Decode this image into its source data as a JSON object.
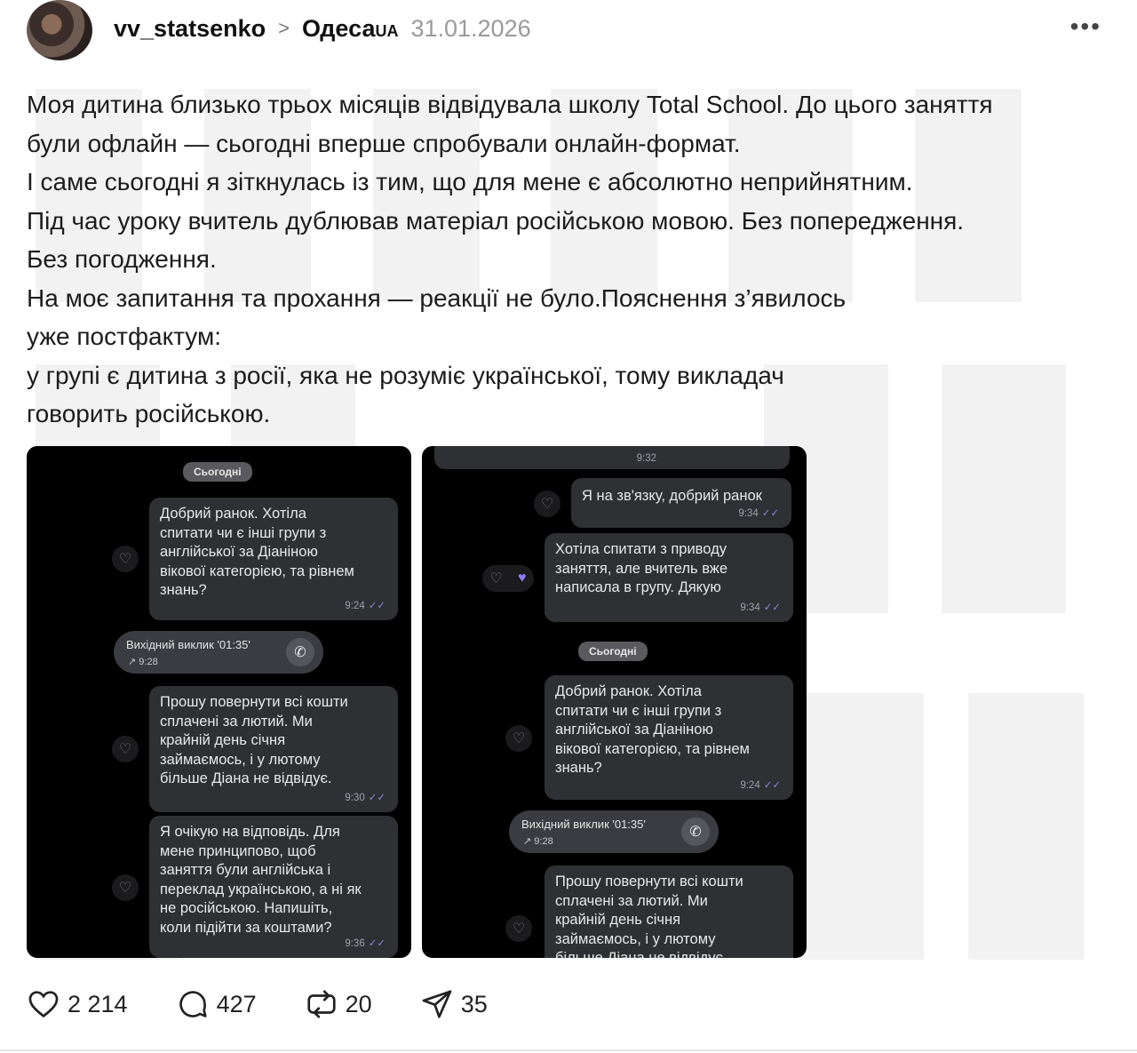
{
  "header": {
    "username": "vv_statsenko",
    "separator": ">",
    "tag": "Одеса",
    "tag_suffix": "UA",
    "date": "31.01.2026",
    "more": "•••"
  },
  "post_text": [
    "Моя дитина близько трьох місяців відвідувала школу Total School. До цього заняття",
    "були офлайн — сьогодні вперше спробували онлайн-формат.",
    "І саме сьогодні я зіткнулась із тим, що для мене є абсолютно неприйнятним.",
    "Під час уроку вчитель дублював матеріал російською мовою. Без попередження.",
    "Без погодження.",
    "На моє запитання та прохання — реакції не було.Пояснення з’явилось",
    "уже постфактум:",
    "у групі є дитина з росії, яка не розуміє української, тому викладач",
    "говорить російською."
  ],
  "screenshot_left": {
    "date_pill": "Сьогодні",
    "msg1": {
      "text": "Добрий ранок. Хотіла\nспитати чи є інші групи з\nанглійської за Діаніною\nвікової категорією, та рівнем\nзнань?",
      "time": "9:24"
    },
    "call": {
      "label": "Вихідний виклик '01:35'",
      "sub": "↗ 9:28"
    },
    "msg2": {
      "text": "Прошу повернути всі кошти\nсплачені за лютий. Ми\nкрайній день січня\nзаймаємось, і у лютому\nбільше Діана не відвідує.",
      "time": "9:30"
    },
    "msg3": {
      "text": "Я очікую на відповідь. Для\nмене принципово, щоб\nзаняття були англійська і\nпереклад українською, а ні як\nне російською. Напишіть,\nколи підійти за коштами?",
      "time": "9:36"
    }
  },
  "screenshot_right": {
    "top_time": "9:32",
    "msg1": {
      "text": "Я на зв'язку, добрий ранок",
      "time": "9:34"
    },
    "msg2": {
      "text": "Хотіла спитати з приводу\nзаняття, але вчитель вже\nнаписала в групу. Дякую",
      "time": "9:34"
    },
    "date_pill": "Сьогодні",
    "msg3": {
      "text": "Добрий ранок. Хотіла\nспитати чи є інші групи з\nанглійської за Діаніною\nвікової категорією, та рівнем\nзнань?",
      "time": "9:24"
    },
    "call": {
      "label": "Вихідний виклик '01:35'",
      "sub": "↗ 9:28"
    },
    "msg4": {
      "text": "Прошу повернути всі кошти\nсплачені за лютий. Ми\nкрайній день січня\nзаймаємось, і у лютому\nбільше Діана не відвідує."
    }
  },
  "actions": {
    "likes": "2 214",
    "comments": "427",
    "reposts": "20",
    "shares": "35"
  }
}
